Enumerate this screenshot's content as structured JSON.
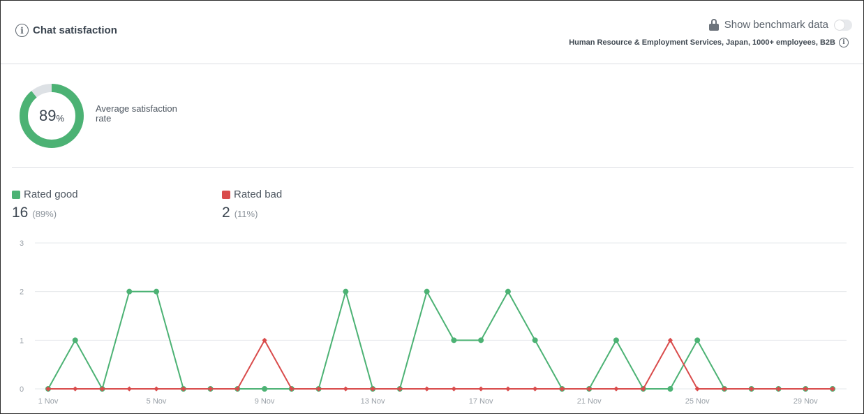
{
  "header": {
    "title": "Chat satisfaction",
    "benchmark_label": "Show benchmark data",
    "benchmark_enabled": false,
    "segment": "Human Resource & Employment Services, Japan, 1000+ employees, B2B"
  },
  "summary": {
    "rate_value": "89",
    "rate_unit": "%",
    "rate_fraction": 0.89,
    "rate_label": "Average satisfaction rate"
  },
  "legend": {
    "good": {
      "label": "Rated good",
      "count": "16",
      "percent": "(89%)"
    },
    "bad": {
      "label": "Rated bad",
      "count": "2",
      "percent": "(11%)"
    }
  },
  "colors": {
    "good": "#4cb274",
    "bad": "#d94b4b",
    "ring_track": "#dde1e5",
    "grid": "#e6e8eb"
  },
  "chart_data": {
    "type": "line",
    "x": [
      "1 Nov",
      "2 Nov",
      "3 Nov",
      "4 Nov",
      "5 Nov",
      "6 Nov",
      "7 Nov",
      "8 Nov",
      "9 Nov",
      "10 Nov",
      "11 Nov",
      "12 Nov",
      "13 Nov",
      "14 Nov",
      "15 Nov",
      "16 Nov",
      "17 Nov",
      "18 Nov",
      "19 Nov",
      "20 Nov",
      "21 Nov",
      "22 Nov",
      "23 Nov",
      "24 Nov",
      "25 Nov",
      "26 Nov",
      "27 Nov",
      "28 Nov",
      "29 Nov",
      "30 Nov"
    ],
    "x_tick_labels": [
      "1 Nov",
      "5 Nov",
      "9 Nov",
      "13 Nov",
      "17 Nov",
      "21 Nov",
      "25 Nov",
      "29 Nov"
    ],
    "y_ticks": [
      0,
      1,
      2,
      3
    ],
    "ylim": [
      0,
      3
    ],
    "grid": true,
    "series": [
      {
        "name": "Rated good",
        "values": [
          0,
          1,
          0,
          2,
          2,
          0,
          0,
          0,
          0,
          0,
          0,
          2,
          0,
          0,
          2,
          1,
          1,
          2,
          1,
          0,
          0,
          1,
          0,
          0,
          1,
          0,
          0,
          0,
          0,
          0
        ]
      },
      {
        "name": "Rated bad",
        "values": [
          0,
          0,
          0,
          0,
          0,
          0,
          0,
          0,
          1,
          0,
          0,
          0,
          0,
          0,
          0,
          0,
          0,
          0,
          0,
          0,
          0,
          0,
          0,
          1,
          0,
          0,
          0,
          0,
          0,
          0
        ]
      }
    ]
  }
}
